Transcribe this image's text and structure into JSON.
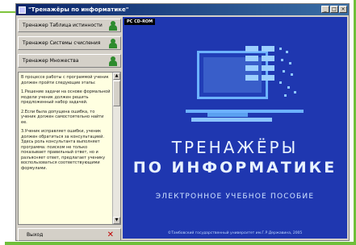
{
  "window": {
    "title": "\"Тренажёры по информатике\"",
    "buttons": {
      "minimize": "_",
      "maximize": "□",
      "close": "×"
    }
  },
  "sidebar": {
    "items": [
      {
        "label": "Тренажер Таблица истинности",
        "icon": "person-icon"
      },
      {
        "label": "Тренажер Системы счисления",
        "icon": "person-icon"
      },
      {
        "label": "Тренажер Множества",
        "icon": "person-icon"
      }
    ],
    "instructions": [
      "В процессе работы с программой ученик должен пройти следующие этапы:",
      "1.Решение задачи на основе формальной модели ученик должен решить предложенный набор задачей.",
      "2.Если была допущена ошибка, то ученик должен самостоятельно найти ее.",
      "3.Ученик исправляет ошибки, ученик должен обратиться за консультацией. Здесь роль консультанта выполняет программа: поиском не только показывает правильный ответ, но и разъясняет ответ, предлагает ученику воспользоваться соответствующими формулами."
    ],
    "exit_label": "Выход",
    "exit_icon": "close-icon"
  },
  "main": {
    "badge": "PC CD-ROM",
    "title_line1": "ТРЕНАЖЁРЫ",
    "title_line2": "ПО ИНФОРМАТИКЕ",
    "subtitle": "ЭЛЕКТРОННОЕ УЧЕБНОЕ ПОСОБИЕ",
    "footer": "©Тамбовский государственный университет им.Г.Р.Державина, 2005",
    "illustration": "computer-icon"
  },
  "colors": {
    "main_bg": "#1f37b0",
    "accent": "#6fbf3a",
    "titlebar": "#0a246a"
  }
}
